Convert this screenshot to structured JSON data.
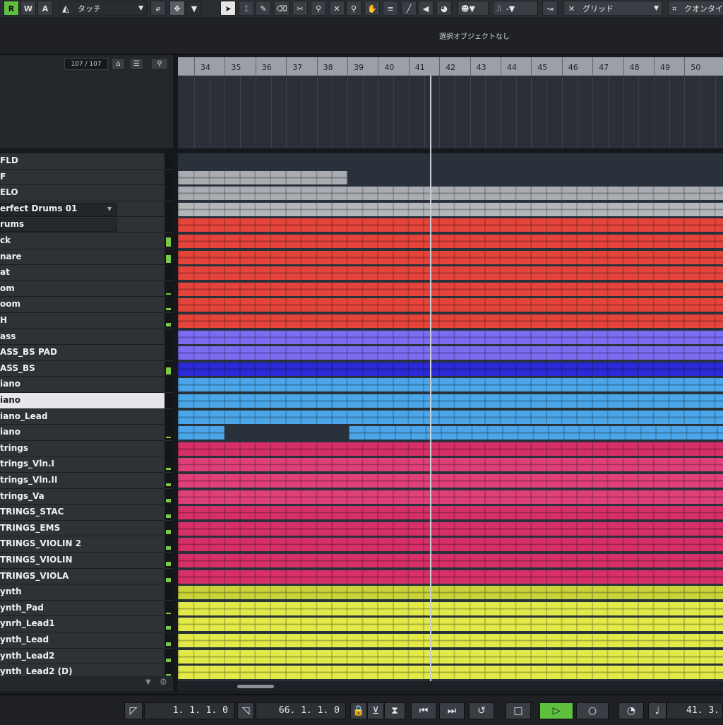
{
  "toolbar": {
    "modes": [
      "R",
      "W",
      "A"
    ],
    "touch_mode": "タッチ",
    "grid_type": "グリッド",
    "quantize_label": "クオンタイ",
    "snap_value": "-",
    "icons": [
      "touch-mode-icon",
      "e-icon",
      "snap-icon",
      "select-icon",
      "range-icon",
      "pencil-icon",
      "eraser-icon",
      "scissors-icon",
      "glue-icon",
      "mute-icon",
      "zoom-icon",
      "hand-icon",
      "comp-icon",
      "line-icon",
      "speaker-icon",
      "color-icon",
      "face-icon",
      "pulse-icon",
      "warp-icon",
      "grid-icon",
      "quantize-icon"
    ],
    "mode_colors": {
      "R": "#5fbf3f",
      "W": "#3a3e44",
      "A": "#3a3e44"
    }
  },
  "info_line": {
    "text": "選択オブジェクトなし"
  },
  "track_header": {
    "count": "107 / 107"
  },
  "ruler": {
    "bars": [
      "34",
      "35",
      "36",
      "37",
      "38",
      "39",
      "40",
      "41",
      "42",
      "43",
      "44",
      "45",
      "46",
      "47",
      "48",
      "49",
      "50"
    ]
  },
  "tracks": [
    {
      "name": "FLD",
      "color": "#3b4450",
      "level": 0
    },
    {
      "name": "F",
      "color": "#a9acb0",
      "level": 0
    },
    {
      "name": "ELO",
      "color": "#a9acb0",
      "level": 0
    },
    {
      "name": "erfect Drums 01",
      "color": "#b4b7ba",
      "level": 0
    },
    {
      "name": "rums",
      "color": "#e5443b",
      "level": 0
    },
    {
      "name": "ck",
      "color": "#e5443b",
      "level": 0.8
    },
    {
      "name": "nare",
      "color": "#e5443b",
      "level": 0.7
    },
    {
      "name": "at",
      "color": "#e5443b",
      "level": 0
    },
    {
      "name": "om",
      "color": "#e5443b",
      "level": 0.15
    },
    {
      "name": "oom",
      "color": "#e5443b",
      "level": 0.2
    },
    {
      "name": "H",
      "color": "#e5443b",
      "level": 0.3
    },
    {
      "name": "ass",
      "color": "#7b6cf2",
      "level": 0
    },
    {
      "name": "ASS_BS PAD",
      "color": "#7b6cf2",
      "level": 0
    },
    {
      "name": "ASS_BS",
      "color": "#2a2ad6",
      "level": 0.6
    },
    {
      "name": "iano",
      "color": "#4aa6e8",
      "level": 0
    },
    {
      "name": "iano",
      "color": "#4aa6e8",
      "level": 0
    },
    {
      "name": "iano_Lead",
      "color": "#4aa6e8",
      "level": 0
    },
    {
      "name": "iano",
      "color": "#4aa6e8",
      "level": 0.1
    },
    {
      "name": "trings",
      "color": "#d73068",
      "level": 0
    },
    {
      "name": "trings_Vln.I",
      "color": "#e0407a",
      "level": 0.2
    },
    {
      "name": "trings_Vln.II",
      "color": "#e0407a",
      "level": 0.25
    },
    {
      "name": "trings_Va",
      "color": "#e0407a",
      "level": 0.3
    },
    {
      "name": "TRINGS_STAC",
      "color": "#d73068",
      "level": 0.3
    },
    {
      "name": "TRINGS_EMS",
      "color": "#d73068",
      "level": 0.35
    },
    {
      "name": "TRINGS_VIOLIN 2",
      "color": "#d73068",
      "level": 0.3
    },
    {
      "name": "TRINGS_VIOLIN",
      "color": "#d73068",
      "level": 0.35
    },
    {
      "name": "TRINGS_VIOLA",
      "color": "#d73068",
      "level": 0.35
    },
    {
      "name": "ynth",
      "color": "#c9d33a",
      "level": 0
    },
    {
      "name": "ynth_Pad",
      "color": "#e2ea4a",
      "level": 0.15
    },
    {
      "name": "ynrh_Lead1",
      "color": "#e2ea4a",
      "level": 0.3
    },
    {
      "name": "ynth_Lead",
      "color": "#e2ea4a",
      "level": 0.3
    },
    {
      "name": "ynth_Lead2",
      "color": "#e2ea4a",
      "level": 0.3
    },
    {
      "name": "ynth_Lead2 (D)",
      "color": "#e2ea4a",
      "level": 0.3
    }
  ],
  "selected_track": 15,
  "transport": {
    "left_locator": "1. 1. 1.   0",
    "right_locator": "66. 1. 1.   0",
    "position": "41. 3.",
    "icons": [
      "left-locator-icon",
      "right-locator-icon",
      "lock-icon",
      "punch-icon",
      "marker-icon",
      "go-start-icon",
      "go-end-icon",
      "cycle-icon",
      "stop-icon",
      "play-icon",
      "record-icon",
      "tempo-icon",
      "metronome-icon"
    ],
    "play_color": "#5fbf3f"
  }
}
